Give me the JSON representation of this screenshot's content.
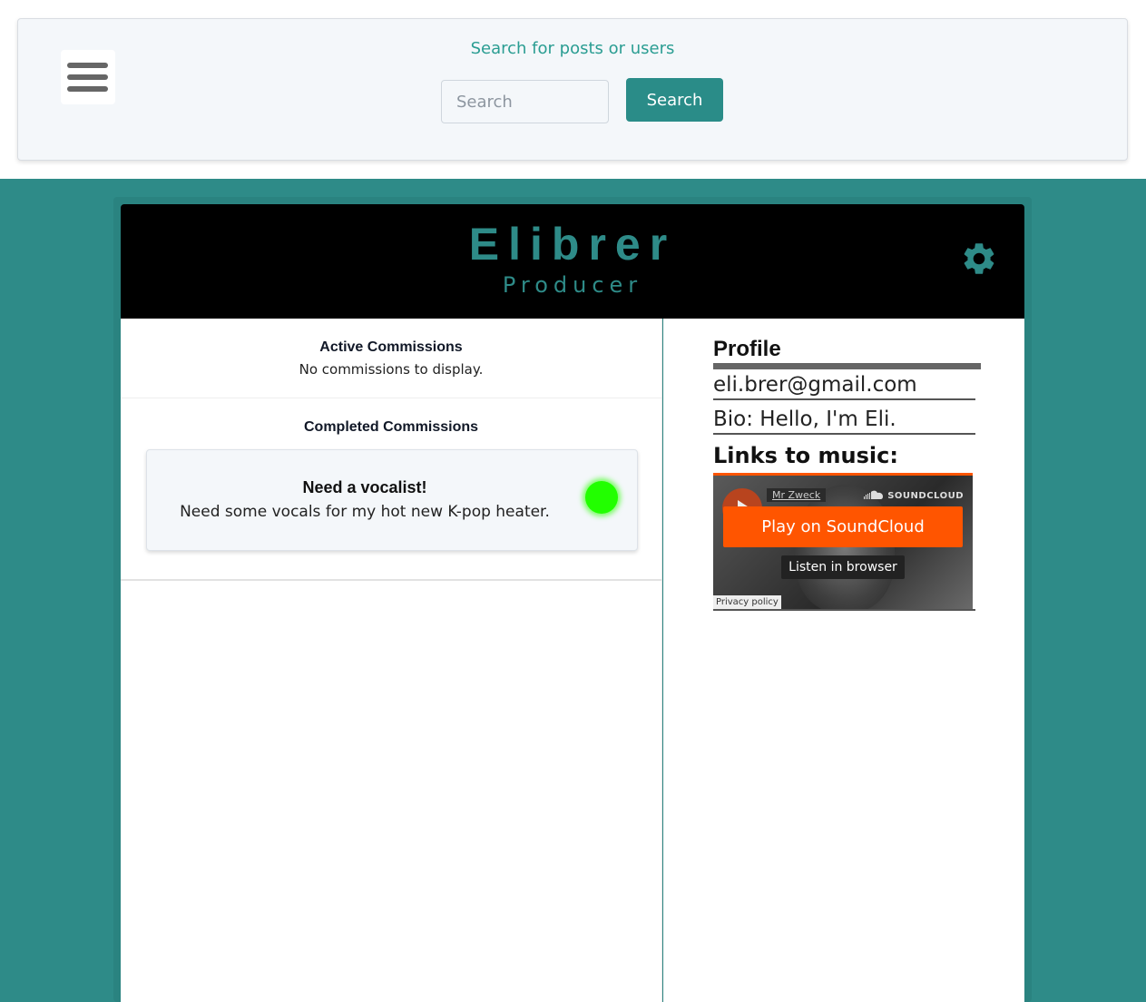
{
  "search": {
    "caption": "Search for posts or users",
    "placeholder": "Search",
    "button_label": "Search"
  },
  "profile_header": {
    "name": "Elibrer",
    "role": "Producer",
    "settings_icon": "gear-icon"
  },
  "commissions": {
    "active_title": "Active Commissions",
    "active_empty": "No commissions to display.",
    "completed_title": "Completed Commissions",
    "completed": [
      {
        "title": "Need a vocalist!",
        "description": "Need some vocals for my hot new K-pop heater.",
        "status_color": "#22ff00"
      }
    ]
  },
  "profile": {
    "heading": "Profile",
    "email": "eli.brer@gmail.com",
    "bio": "Bio: Hello, I'm Eli.",
    "links_heading": "Links to music:"
  },
  "soundcloud": {
    "artist": "Mr Zweck",
    "brand": "SOUNDCLOUD",
    "play_label": "Play on SoundCloud",
    "listen_label": "Listen in browser",
    "privacy_label": "Privacy policy"
  },
  "colors": {
    "accent": "#2e8b88",
    "soundcloud_orange": "#ff5500"
  }
}
